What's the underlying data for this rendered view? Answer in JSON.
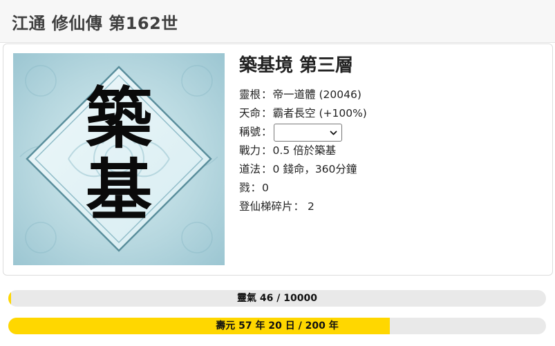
{
  "header": {
    "title": "江通 修仙傳 第162世"
  },
  "character": {
    "realm_image_icon": "realm-calligraphy-icon",
    "realm_image_glyphs": [
      "築",
      "基"
    ],
    "realm_title": "築基境 第三層",
    "fields": {
      "spirit_root_label": "靈根",
      "spirit_root_value": "帝一道體 (20046)",
      "destiny_label": "天命",
      "destiny_value": "霸者長空 (+100%)",
      "title_label": "稱號",
      "title_selected": "",
      "power_label": "戰力",
      "power_value": "0.5 倍於築基",
      "dao_label": "道法",
      "dao_value": "0 錢命，360分鐘",
      "kills_label": "戮",
      "kills_value": "0",
      "ladder_label": "登仙梯碎片",
      "ladder_value": "2"
    },
    "colon": "："
  },
  "bars": {
    "qi": {
      "label": "靈氣 46 / 10000",
      "current": 46,
      "max": 10000,
      "fill_color": "#ffd700",
      "fill_fraction": 0.0046
    },
    "lifespan": {
      "label": "壽元 57 年 20 日 / 200 年",
      "fill_color": "#ffd700",
      "fill_fraction": 0.71
    }
  },
  "colors": {
    "header_bg": "#f7f7f7",
    "bar_track": "#e9e9e9",
    "bar_fill": "#ffd700",
    "image_bg": "#b8d8e0"
  }
}
